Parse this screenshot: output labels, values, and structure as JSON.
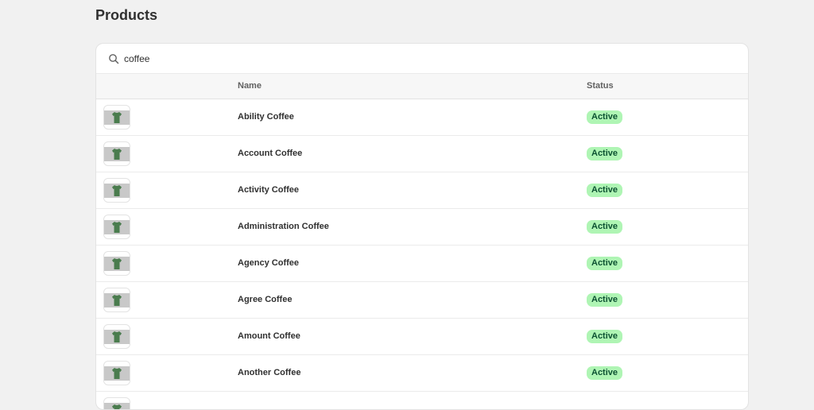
{
  "page": {
    "title": "Products"
  },
  "search": {
    "value": "coffee",
    "icon": "search-icon"
  },
  "table": {
    "columns": {
      "image": "",
      "name": "Name",
      "status": "Status"
    },
    "rows": [
      {
        "name": "Ability Coffee",
        "status": "Active"
      },
      {
        "name": "Account Coffee",
        "status": "Active"
      },
      {
        "name": "Activity Coffee",
        "status": "Active"
      },
      {
        "name": "Administration Coffee",
        "status": "Active"
      },
      {
        "name": "Agency Coffee",
        "status": "Active"
      },
      {
        "name": "Agree Coffee",
        "status": "Active"
      },
      {
        "name": "Amount Coffee",
        "status": "Active"
      },
      {
        "name": "Another Coffee",
        "status": "Active"
      },
      {
        "name": "",
        "status": ""
      }
    ]
  },
  "colors": {
    "background": "#f1f1f1",
    "badge_active_bg": "#aff5b4",
    "badge_active_text": "#0c5132",
    "thumbnail_shirt": "#4a7c4e"
  }
}
